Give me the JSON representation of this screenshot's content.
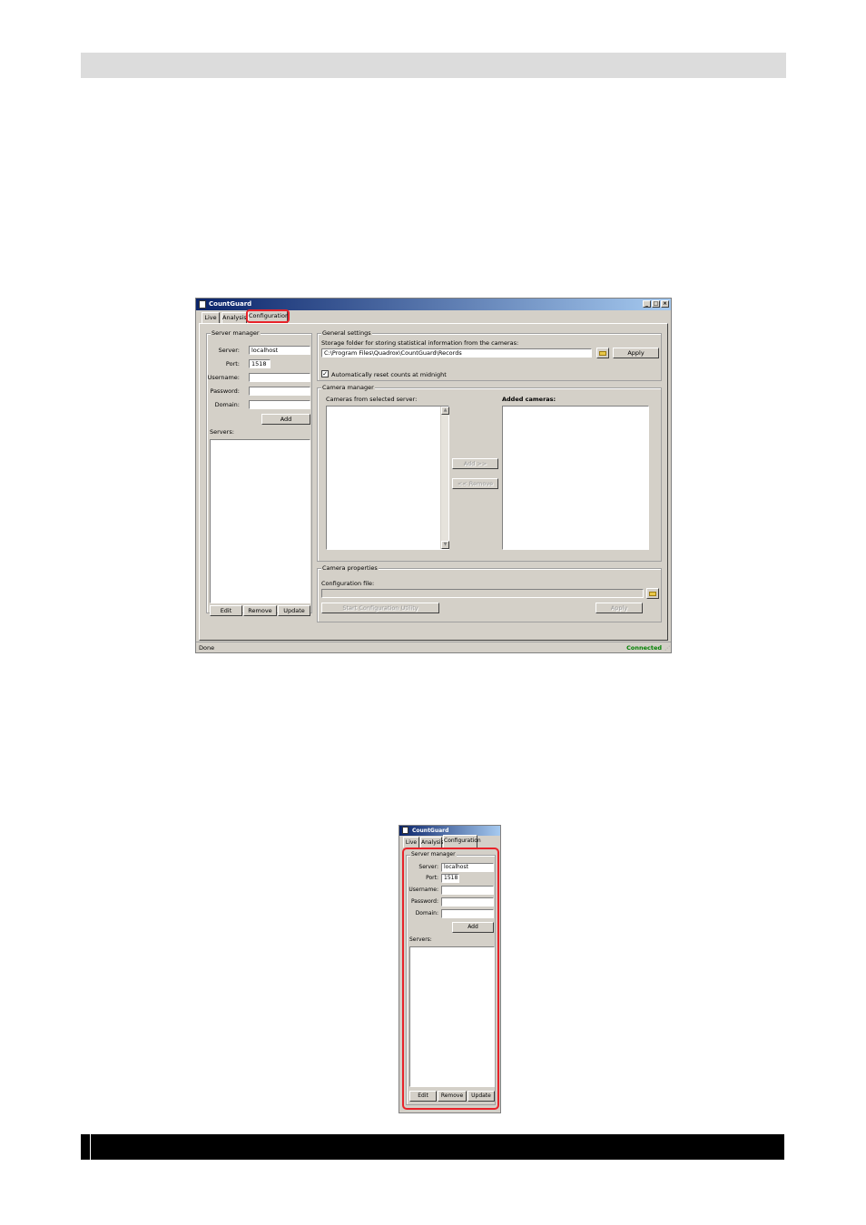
{
  "window": {
    "title": "CountGuard",
    "tabs": [
      "Live",
      "Analysis",
      "Configuration"
    ],
    "min_glyph": "_",
    "max_glyph": "□",
    "close_glyph": "×"
  },
  "server_manager": {
    "title": "Server manager",
    "server_label": "Server:",
    "server_value": "localhost",
    "port_label": "Port:",
    "port_value": "1518",
    "username_label": "Username:",
    "password_label": "Password:",
    "domain_label": "Domain:",
    "add_button": "Add",
    "servers_label": "Servers:",
    "edit_button": "Edit",
    "remove_button": "Remove",
    "update_button": "Update"
  },
  "general_settings": {
    "title": "General settings",
    "storage_label": "Storage folder for storing statistical information from the cameras:",
    "storage_path": "C:\\Program Files\\Quadrox\\CountGuard\\Records",
    "apply_button": "Apply",
    "reset_checkbox_label": "Automatically reset counts at midnight",
    "reset_checked": true,
    "check_glyph": "✓"
  },
  "camera_manager": {
    "title": "Camera manager",
    "from_server_label": "Cameras from selected server:",
    "added_label": "Added cameras:",
    "add_button": "Add >>",
    "remove_button": "<< Remove",
    "up_arrow": "▲",
    "down_arrow": "▼"
  },
  "camera_properties": {
    "title": "Camera properties",
    "config_file_label": "Configuration file:",
    "start_utility_button": "Start Configuration Utility",
    "apply_button": "Apply"
  },
  "status_bar": {
    "left_text": "Done",
    "right_text": "Connected",
    "grip": "⋰"
  },
  "colors": {
    "highlight": "#e8232a",
    "connected": "#008000",
    "window_bg": "#d4d0c8"
  }
}
